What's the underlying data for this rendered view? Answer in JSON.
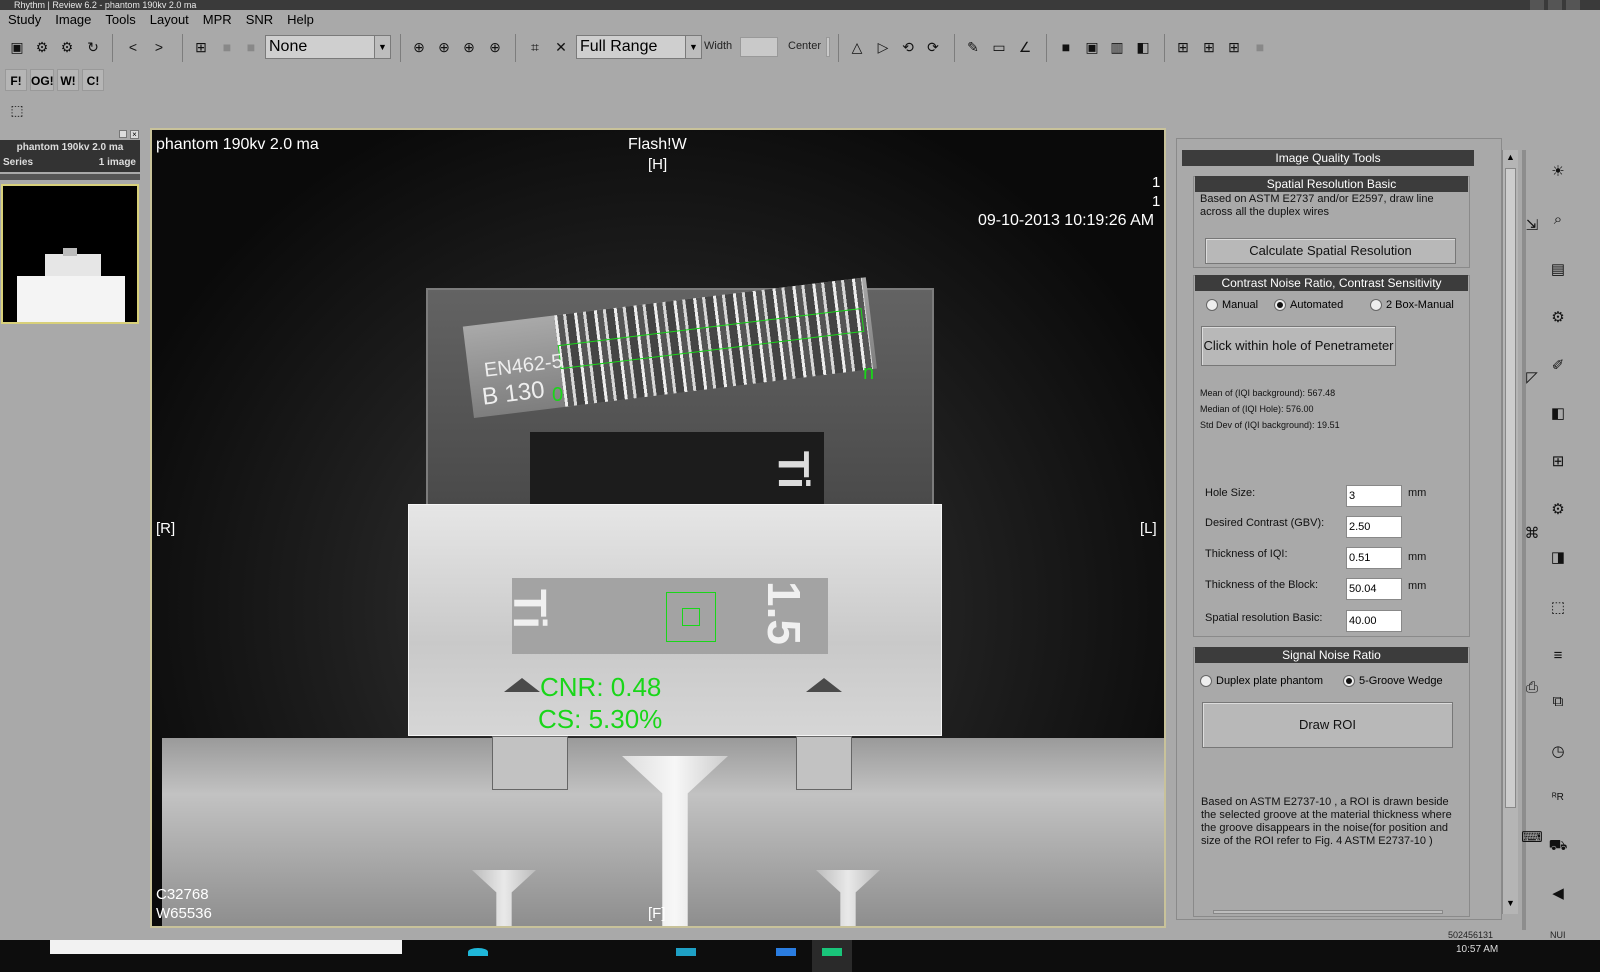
{
  "window": {
    "title": "Rhythm | Review 6.2 - phantom 190kv 2.0 ma"
  },
  "menu": [
    "Study",
    "Image",
    "Tools",
    "Layout",
    "MPR",
    "SNR",
    "Help"
  ],
  "toolbar": {
    "layout_combo": "None",
    "range_combo": "Full Range",
    "width_label": "Width",
    "center_label": "Center",
    "width_value": "",
    "center_value": ""
  },
  "flags": [
    "F!",
    "OG!",
    "W!",
    "C!"
  ],
  "series_panel": {
    "title": "phantom 190kv 2.0 ma",
    "series_label": "Series",
    "count": "1 image"
  },
  "viewer": {
    "top_left": "phantom 190kv 2.0 ma",
    "top_center": "Flash!W",
    "top_center_orient": "[H]",
    "top_right_1": "1",
    "top_right_2": "1",
    "datetime": "09-10-2013 10:19:26 AM",
    "left_orient": "[R]",
    "right_orient": "[L]",
    "bottom_orient": "[F]",
    "bottom_left_1": "C32768",
    "bottom_left_2": "W65536",
    "iqi_label_1": "EN462-5",
    "iqi_label_2": "B 130",
    "wire_start": "0",
    "wire_end": "n",
    "plate_label_1": "Ti",
    "plate_label_2": "1.5",
    "upper_plate_label": "Ti",
    "cnr": "CNR: 0.48",
    "cs": "CS: 5.30%"
  },
  "quality_tools": {
    "title": "Image Quality Tools",
    "spatial": {
      "title": "Spatial Resolution Basic",
      "desc": "Based on ASTM E2737 and/or E2597, draw line across all the duplex wires",
      "button": "Calculate Spatial Resolution"
    },
    "cnr": {
      "title": "Contrast Noise Ratio, Contrast Sensitivity",
      "modes": [
        "Manual",
        "Automated",
        "2 Box-Manual"
      ],
      "selected_mode": "Automated",
      "button": "Click within hole of Penetrameter",
      "stats": [
        "Mean of (IQI background): 567.48",
        "Median of (IQI Hole): 576.00",
        "Std Dev of (IQI background): 19.51"
      ],
      "fields": [
        {
          "label": "Hole Size:",
          "value": "3",
          "unit": "mm"
        },
        {
          "label": "Desired Contrast (GBV):",
          "value": "2.50",
          "unit": ""
        },
        {
          "label": "Thickness of IQI:",
          "value": "0.51",
          "unit": "mm"
        },
        {
          "label": "Thickness of the Block:",
          "value": "50.04",
          "unit": "mm"
        },
        {
          "label": "Spatial resolution Basic:",
          "value": "40.00",
          "unit": ""
        }
      ]
    },
    "snr": {
      "title": "Signal Noise Ratio",
      "modes": [
        "Duplex plate phantom",
        "5-Groove Wedge"
      ],
      "selected_mode": "5-Groove Wedge",
      "button": "Draw ROI",
      "desc": "Based on ASTM E2737-10 , a ROI is drawn beside the selected groove at the material thickness where the groove disappears in the noise(for position and size of the ROI refer to Fig. 4 ASTM E2737-10 )"
    }
  },
  "status": {
    "code": "502456131",
    "tag": "NUI",
    "clock": "10:57 AM"
  },
  "colors": {
    "overlay_green": "#19d619",
    "viewer_border": "#c8c29a",
    "panel_title_bg": "#3c3c3c"
  }
}
